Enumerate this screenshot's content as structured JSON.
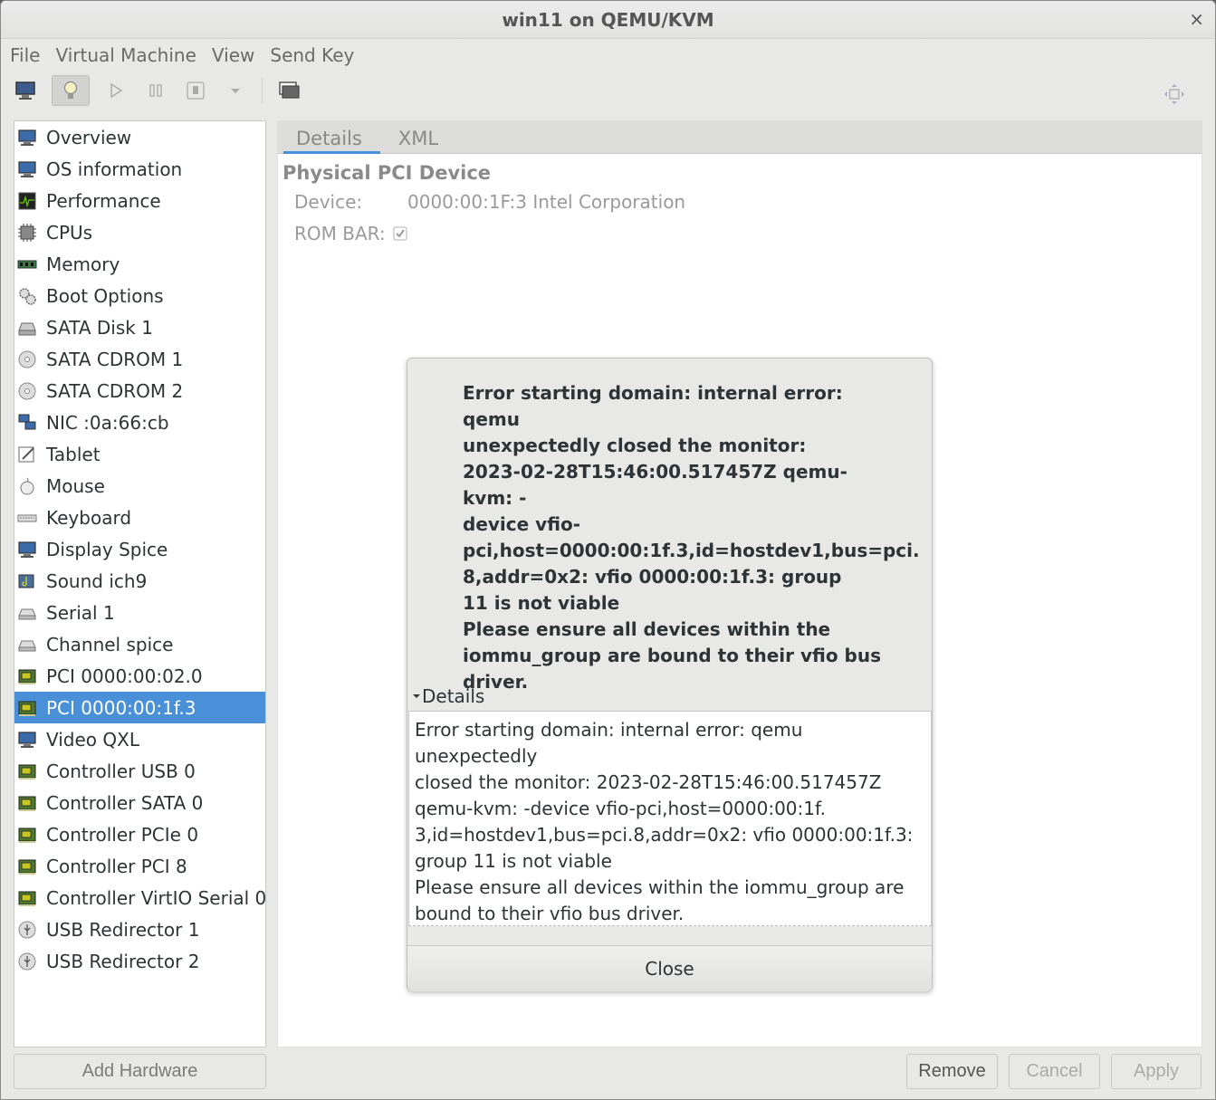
{
  "window": {
    "title": "win11 on QEMU/KVM",
    "close_glyph": "×"
  },
  "menubar": {
    "items": [
      "File",
      "Virtual Machine",
      "View",
      "Send Key"
    ]
  },
  "toolbar": {
    "buttons": [
      "monitor-icon",
      "lightbulb-icon",
      "play-icon",
      "pause-icon",
      "stop-icon",
      "dropdown-icon",
      "screens-icon",
      "fullscreen-icon"
    ]
  },
  "sidebar": {
    "items": [
      {
        "label": "Overview",
        "icon": "monitor-icon"
      },
      {
        "label": "OS information",
        "icon": "monitor-icon"
      },
      {
        "label": "Performance",
        "icon": "chart-icon"
      },
      {
        "label": "CPUs",
        "icon": "chip-icon"
      },
      {
        "label": "Memory",
        "icon": "ram-icon"
      },
      {
        "label": "Boot Options",
        "icon": "gear-icon"
      },
      {
        "label": "SATA Disk 1",
        "icon": "disk-icon"
      },
      {
        "label": "SATA CDROM 1",
        "icon": "cdrom-icon"
      },
      {
        "label": "SATA CDROM 2",
        "icon": "cdrom-icon"
      },
      {
        "label": "NIC :0a:66:cb",
        "icon": "network-icon"
      },
      {
        "label": "Tablet",
        "icon": "tablet-icon"
      },
      {
        "label": "Mouse",
        "icon": "mouse-icon"
      },
      {
        "label": "Keyboard",
        "icon": "keyboard-icon"
      },
      {
        "label": "Display Spice",
        "icon": "monitor-icon"
      },
      {
        "label": "Sound ich9",
        "icon": "sound-icon"
      },
      {
        "label": "Serial 1",
        "icon": "serial-icon"
      },
      {
        "label": "Channel spice",
        "icon": "serial-icon"
      },
      {
        "label": "PCI 0000:00:02.0",
        "icon": "pci-card-icon"
      },
      {
        "label": "PCI 0000:00:1f.3",
        "icon": "pci-card-icon",
        "selected": true
      },
      {
        "label": "Video QXL",
        "icon": "monitor-icon"
      },
      {
        "label": "Controller USB 0",
        "icon": "pci-card-icon"
      },
      {
        "label": "Controller SATA 0",
        "icon": "pci-card-icon"
      },
      {
        "label": "Controller PCIe 0",
        "icon": "pci-card-icon"
      },
      {
        "label": "Controller PCI 8",
        "icon": "pci-card-icon"
      },
      {
        "label": "Controller VirtIO Serial 0",
        "icon": "pci-card-icon"
      },
      {
        "label": "USB Redirector 1",
        "icon": "usb-icon"
      },
      {
        "label": "USB Redirector 2",
        "icon": "usb-icon"
      }
    ],
    "add_hardware_label": "Add Hardware"
  },
  "main": {
    "tabs": [
      "Details",
      "XML"
    ],
    "section_title": "Physical PCI Device",
    "device_label": "Device:",
    "device_value": "0000:00:1F:3 Intel Corporation",
    "rom_bar_label": "ROM BAR:",
    "rom_bar_checked": true
  },
  "dialog": {
    "message": "Error starting domain: internal error: qemu\nunexpectedly closed the monitor:\n2023-02-28T15:46:00.517457Z qemu-kvm: -\ndevice vfio-\npci,host=0000:00:1f.3,id=hostdev1,bus=pci.\n8,addr=0x2: vfio 0000:00:1f.3: group\n11 is not viable\nPlease ensure all devices within the\niommu_group are bound to their vfio bus\ndriver.",
    "expander_label": "Details",
    "details_text": "Error starting domain: internal error: qemu unexpectedly\nclosed the monitor: 2023-02-28T15:46:00.517457Z\nqemu-kvm: -device vfio-pci,host=0000:00:1f.\n3,id=hostdev1,bus=pci.8,addr=0x2: vfio 0000:00:1f.3:\ngroup 11 is not viable\nPlease ensure all devices within the iommu_group are\nbound to their vfio bus driver.",
    "close_label": "Close"
  },
  "footer": {
    "remove_label": "Remove",
    "cancel_label": "Cancel",
    "apply_label": "Apply"
  },
  "colors": {
    "selection": "#4a90d9",
    "background": "#e8e8e7"
  }
}
